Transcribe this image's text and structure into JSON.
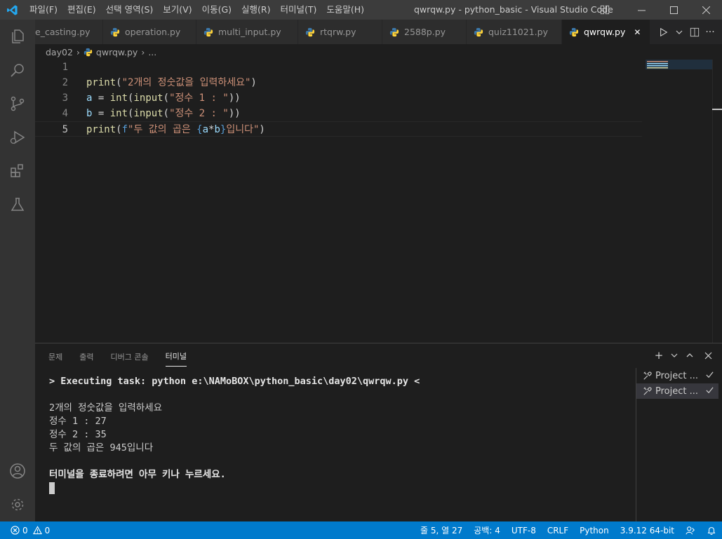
{
  "titlebar": {
    "menu": [
      "파일(F)",
      "편집(E)",
      "선택 영역(S)",
      "보기(V)",
      "이동(G)",
      "실행(R)",
      "터미널(T)",
      "도움말(H)"
    ],
    "title": "qwrqw.py - python_basic - Visual Studio Code"
  },
  "tabs": [
    {
      "label": "e_casting.py",
      "icon": "python-icon"
    },
    {
      "label": "operation.py",
      "icon": "python-icon"
    },
    {
      "label": "multi_input.py",
      "icon": "python-icon"
    },
    {
      "label": "rtqrw.py",
      "icon": "python-icon"
    },
    {
      "label": "2588p.py",
      "icon": "python-icon"
    },
    {
      "label": "quiz11021.py",
      "icon": "python-icon"
    },
    {
      "label": "qwrqw.py",
      "icon": "python-icon",
      "active": true
    }
  ],
  "breadcrumb": {
    "folder": "day02",
    "file": "qwrqw.py",
    "more": "..."
  },
  "editor": {
    "lines": [
      {
        "n": "1",
        "tokens": []
      },
      {
        "n": "2",
        "tokens": [
          [
            "fn",
            "print"
          ],
          [
            "op",
            "("
          ],
          [
            "str",
            "\"2개의 정숫값을 입력하세요\""
          ],
          [
            "op",
            ")"
          ]
        ]
      },
      {
        "n": "3",
        "tokens": [
          [
            "var",
            "a"
          ],
          [
            "op",
            " = "
          ],
          [
            "fn",
            "int"
          ],
          [
            "op",
            "("
          ],
          [
            "fn",
            "input"
          ],
          [
            "op",
            "("
          ],
          [
            "str",
            "\"정수 1 : \""
          ],
          [
            "op",
            "))"
          ]
        ]
      },
      {
        "n": "4",
        "tokens": [
          [
            "var",
            "b"
          ],
          [
            "op",
            " = "
          ],
          [
            "fn",
            "int"
          ],
          [
            "op",
            "("
          ],
          [
            "fn",
            "input"
          ],
          [
            "op",
            "("
          ],
          [
            "str",
            "\"정수 2 : \""
          ],
          [
            "op",
            "))"
          ]
        ]
      },
      {
        "n": "5",
        "tokens": [
          [
            "fn",
            "print"
          ],
          [
            "op",
            "("
          ],
          [
            "kw",
            "f"
          ],
          [
            "str",
            "\"두 값의 곱은 "
          ],
          [
            "kw",
            "{"
          ],
          [
            "var",
            "a"
          ],
          [
            "op",
            "*"
          ],
          [
            "var",
            "b"
          ],
          [
            "kw",
            "}"
          ],
          [
            "str",
            "입니다\""
          ],
          [
            "op",
            ")"
          ]
        ]
      }
    ],
    "current_line": 5
  },
  "panel": {
    "tabs": [
      "문제",
      "출력",
      "디버그 콘솔",
      "터미널"
    ],
    "active_tab": "터미널",
    "terminal_lines": [
      {
        "text": "> Executing task: python e:\\NAMoBOX\\python_basic\\day02\\qwrqw.py <",
        "bold": true
      },
      {
        "text": "",
        "bold": false
      },
      {
        "text": "2개의 정숫값을 입력하세요",
        "bold": false
      },
      {
        "text": "정수 1 : 27",
        "bold": false
      },
      {
        "text": "정수 2 : 35",
        "bold": false
      },
      {
        "text": "두 값의 곱은 945입니다",
        "bold": false
      },
      {
        "text": "",
        "bold": false
      },
      {
        "text": "터미널을 종료하려면 아무 키나 누르세요.",
        "bold": true
      }
    ],
    "terminals": [
      {
        "label": "Project ...",
        "selected": false
      },
      {
        "label": "Project ...",
        "selected": true
      }
    ]
  },
  "statusbar": {
    "errors": "0",
    "warnings": "0",
    "position": "줄 5, 열 27",
    "spaces": "공백: 4",
    "encoding": "UTF-8",
    "eol": "CRLF",
    "language": "Python",
    "interpreter": "3.9.12 64-bit"
  },
  "colors": {
    "accent": "#007acc",
    "vscode_blue": "#23a9f2",
    "python_blue": "#3c78aa",
    "python_yellow": "#ffd43b"
  }
}
